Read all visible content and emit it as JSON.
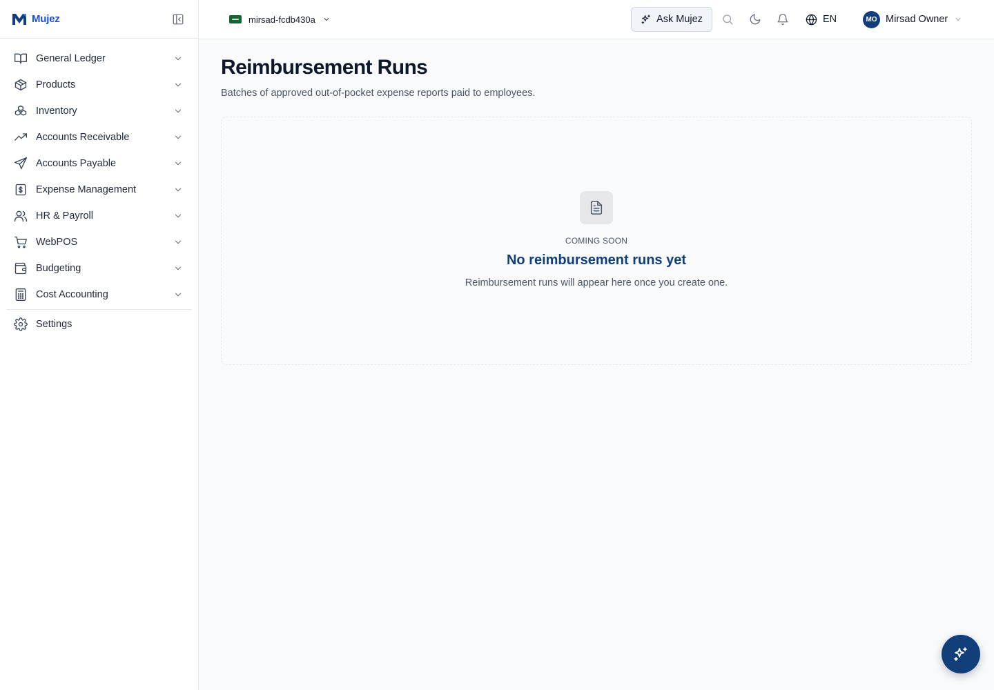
{
  "brand": {
    "name": "Mujez",
    "accent": "#1d4ed8"
  },
  "sidebar": {
    "items": [
      {
        "label": "General Ledger",
        "icon": "book-open-icon"
      },
      {
        "label": "Products",
        "icon": "package-icon"
      },
      {
        "label": "Inventory",
        "icon": "boxes-icon"
      },
      {
        "label": "Accounts Receivable",
        "icon": "trending-up-icon"
      },
      {
        "label": "Accounts Payable",
        "icon": "send-icon"
      },
      {
        "label": "Expense Management",
        "icon": "receipt-dollar-icon"
      },
      {
        "label": "HR & Payroll",
        "icon": "users-icon"
      },
      {
        "label": "WebPOS",
        "icon": "shopping-cart-icon"
      },
      {
        "label": "Budgeting",
        "icon": "wallet-icon"
      },
      {
        "label": "Cost Accounting",
        "icon": "calculator-icon"
      }
    ],
    "settings": {
      "label": "Settings",
      "icon": "gear-icon"
    }
  },
  "topbar": {
    "org": "mirsad-fcdb430a",
    "ask_label": "Ask Mujez",
    "language": "EN",
    "user_initials": "MO",
    "user_name": "Mirsad Owner"
  },
  "page": {
    "title": "Reimbursement Runs",
    "subtitle": "Batches of approved out-of-pocket expense reports paid to employees."
  },
  "empty_state": {
    "badge": "COMING SOON",
    "title": "No reimbursement runs yet",
    "description": "Reimbursement runs will appear here once you create one."
  },
  "colors": {
    "primary": "#123f7a",
    "background": "#f8fafc"
  }
}
